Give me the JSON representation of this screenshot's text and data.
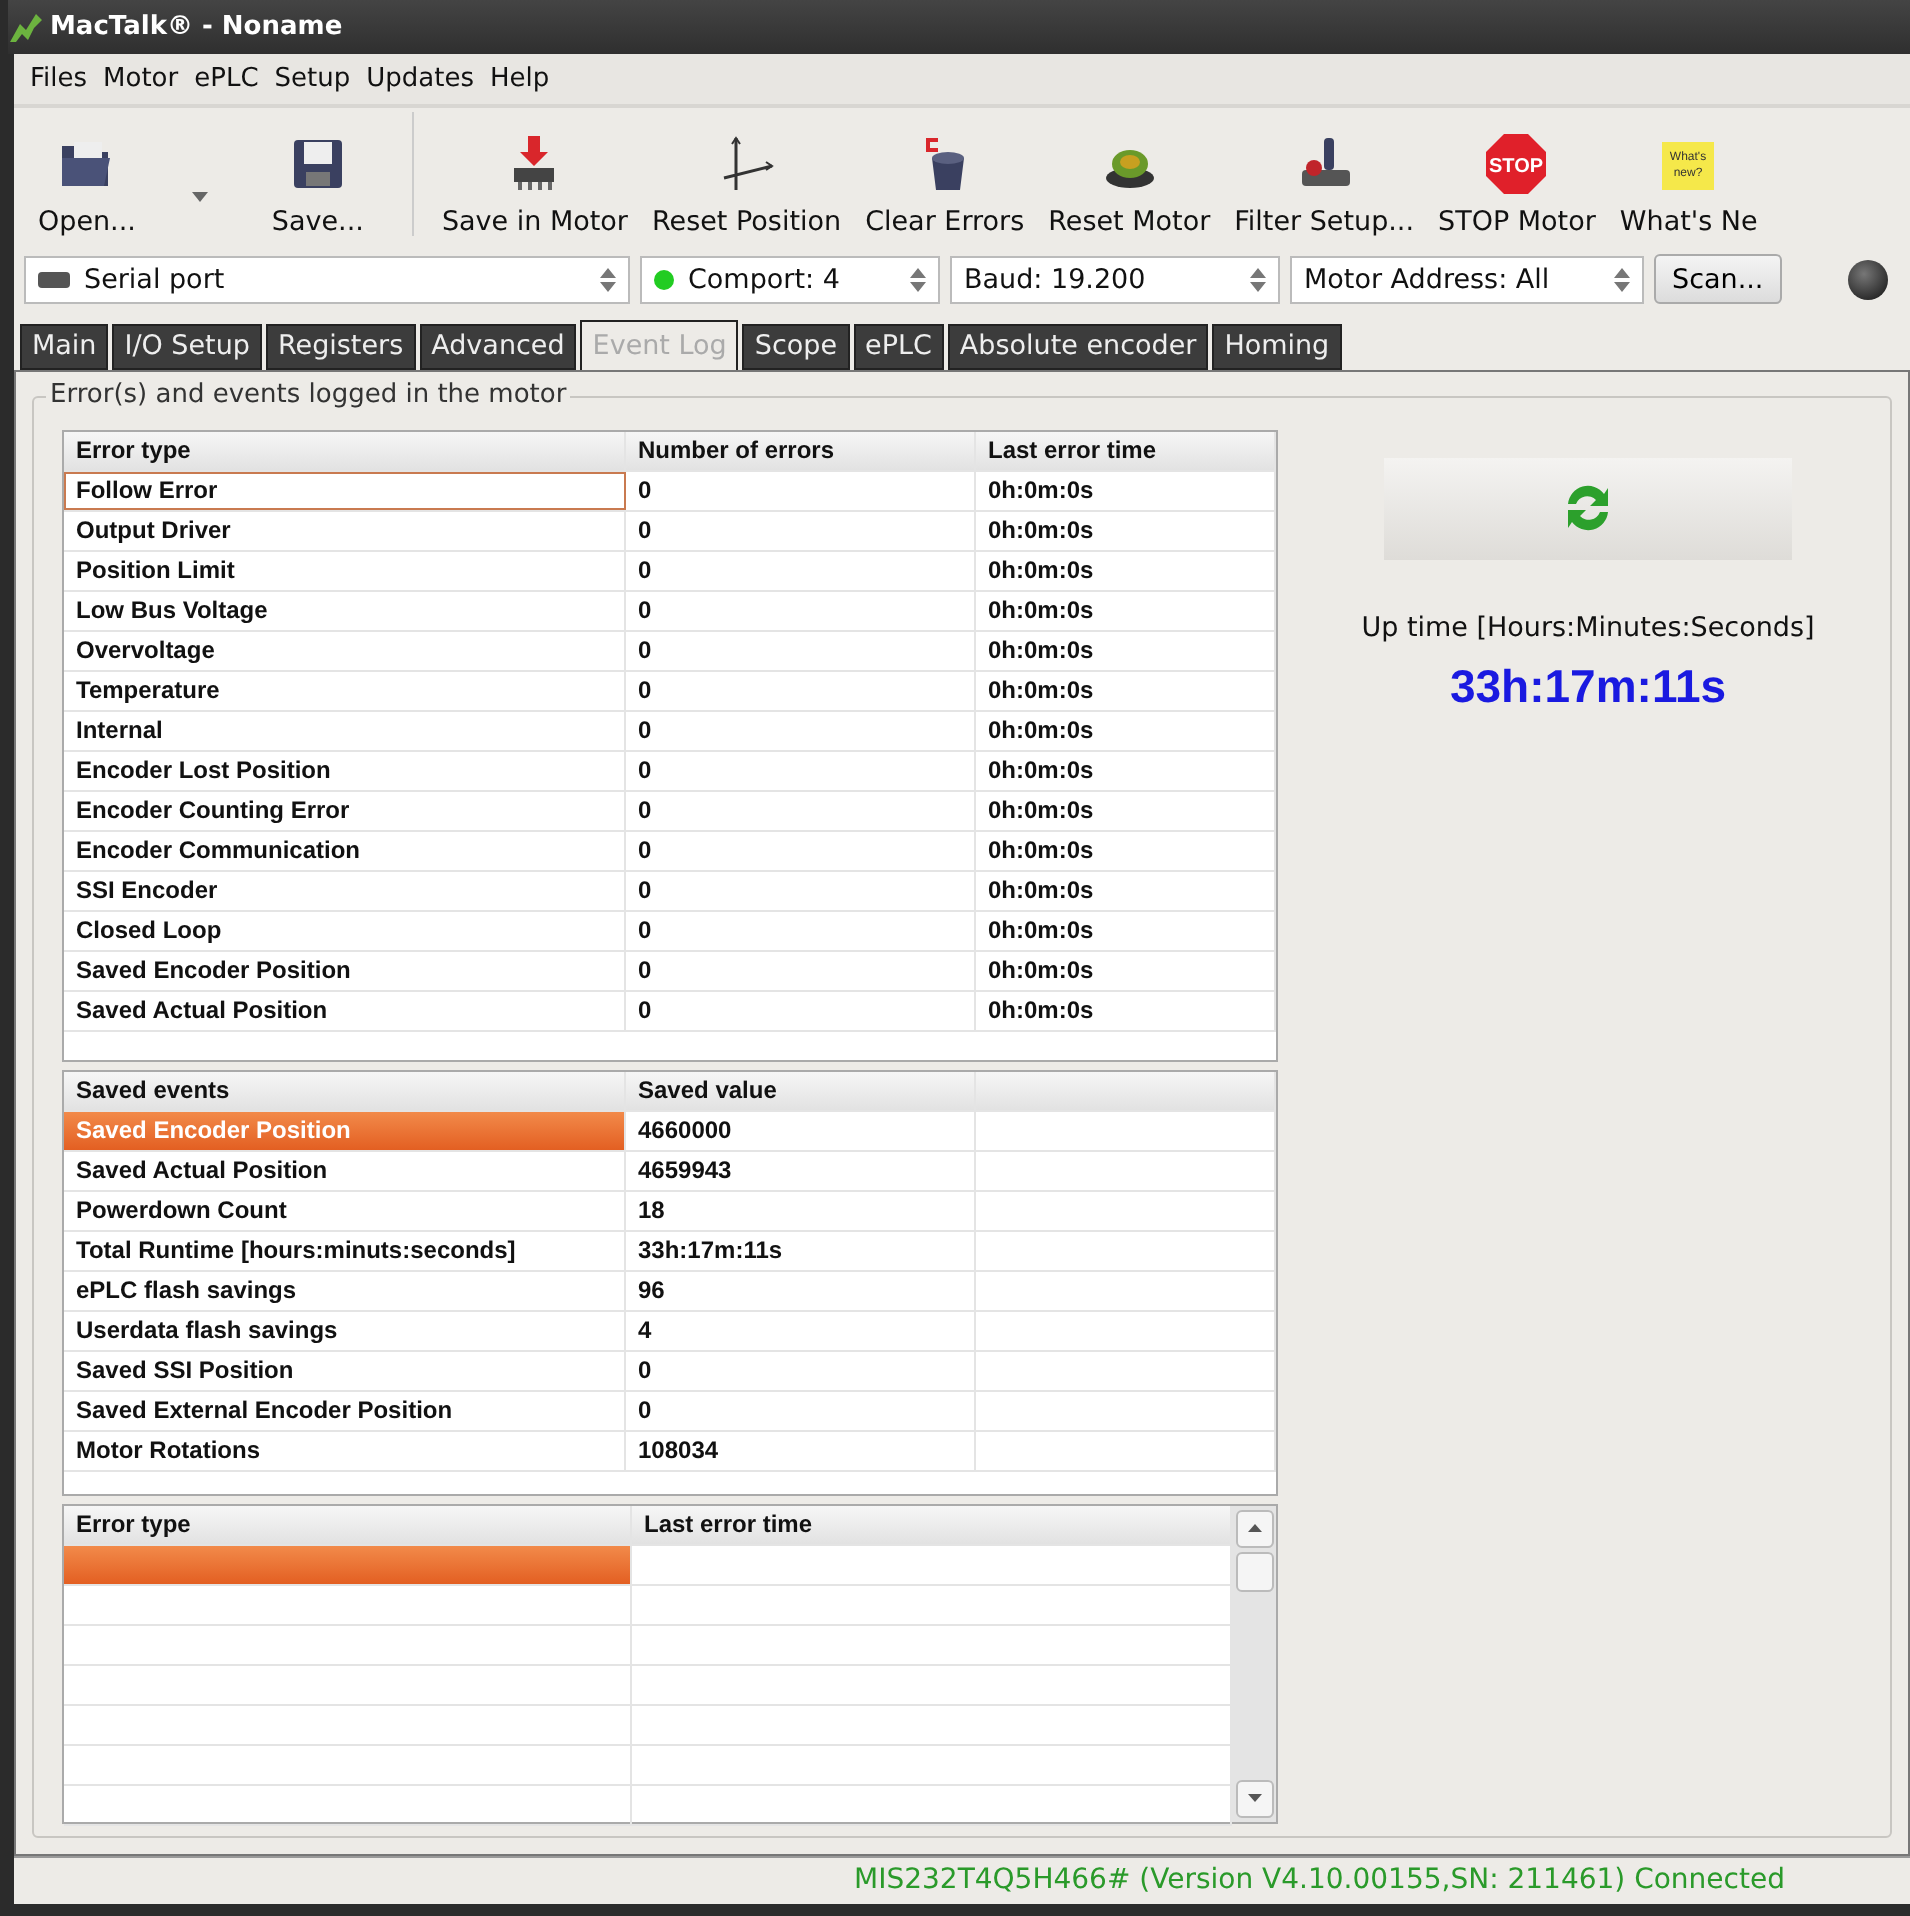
{
  "window": {
    "title": "MacTalk® - Noname"
  },
  "menu": [
    "Files",
    "Motor",
    "ePLC",
    "Setup",
    "Updates",
    "Help"
  ],
  "toolbar": [
    {
      "label": "Open...",
      "has_menu": true
    },
    {
      "label": "Save...",
      "has_menu": false
    },
    {
      "label": "Save in Motor",
      "has_menu": false
    },
    {
      "label": "Reset Position",
      "has_menu": false
    },
    {
      "label": "Clear Errors",
      "has_menu": false
    },
    {
      "label": "Reset Motor",
      "has_menu": false
    },
    {
      "label": "Filter Setup...",
      "has_menu": false
    },
    {
      "label": "STOP Motor",
      "has_menu": false
    },
    {
      "label": "What's Ne",
      "has_menu": false
    }
  ],
  "stop_icon_text": "STOP",
  "note_icon_text": [
    "What's",
    "new?"
  ],
  "connection": {
    "port": "Serial port",
    "comport": "Comport: 4",
    "comport_connected": true,
    "baud": "Baud: 19.200",
    "address": "Motor Address: All",
    "scan": "Scan..."
  },
  "tabs": [
    {
      "label": "Main",
      "selected": false
    },
    {
      "label": "I/O Setup",
      "selected": false
    },
    {
      "label": "Registers",
      "selected": false
    },
    {
      "label": "Advanced",
      "selected": false
    },
    {
      "label": "Event Log",
      "selected": true
    },
    {
      "label": "Scope",
      "selected": false
    },
    {
      "label": "ePLC",
      "selected": false
    },
    {
      "label": "Absolute encoder",
      "selected": false
    },
    {
      "label": "Homing",
      "selected": false
    }
  ],
  "group_title": "Error(s) and events logged in the motor",
  "error_table": {
    "columns": [
      "Error type",
      "Number of errors",
      "Last error time"
    ],
    "rows": [
      {
        "cells": [
          "Follow Error",
          "0",
          "0h:0m:0s"
        ],
        "focused": true
      },
      {
        "cells": [
          "Output Driver",
          "0",
          "0h:0m:0s"
        ],
        "focused": false
      },
      {
        "cells": [
          "Position Limit",
          "0",
          "0h:0m:0s"
        ],
        "focused": false
      },
      {
        "cells": [
          "Low Bus Voltage",
          "0",
          "0h:0m:0s"
        ],
        "focused": false
      },
      {
        "cells": [
          "Overvoltage",
          "0",
          "0h:0m:0s"
        ],
        "focused": false
      },
      {
        "cells": [
          "Temperature",
          "0",
          "0h:0m:0s"
        ],
        "focused": false
      },
      {
        "cells": [
          "Internal",
          "0",
          "0h:0m:0s"
        ],
        "focused": false
      },
      {
        "cells": [
          "Encoder Lost Position",
          "0",
          "0h:0m:0s"
        ],
        "focused": false
      },
      {
        "cells": [
          "Encoder Counting Error",
          "0",
          "0h:0m:0s"
        ],
        "focused": false
      },
      {
        "cells": [
          "Encoder Communication",
          "0",
          "0h:0m:0s"
        ],
        "focused": false
      },
      {
        "cells": [
          "SSI Encoder",
          "0",
          "0h:0m:0s"
        ],
        "focused": false
      },
      {
        "cells": [
          "Closed Loop",
          "0",
          "0h:0m:0s"
        ],
        "focused": false
      },
      {
        "cells": [
          "Saved Encoder Position",
          "0",
          "0h:0m:0s"
        ],
        "focused": false
      },
      {
        "cells": [
          "Saved Actual Position",
          "0",
          "0h:0m:0s"
        ],
        "focused": false
      }
    ]
  },
  "events_table": {
    "columns": [
      "Saved events",
      "Saved value"
    ],
    "rows": [
      {
        "cells": [
          "Saved Encoder Position",
          "4660000"
        ],
        "selected": true
      },
      {
        "cells": [
          "Saved Actual Position",
          "4659943"
        ],
        "selected": false
      },
      {
        "cells": [
          "Powerdown Count",
          "18"
        ],
        "selected": false
      },
      {
        "cells": [
          "Total Runtime [hours:minuts:seconds]",
          "33h:17m:11s"
        ],
        "selected": false
      },
      {
        "cells": [
          "ePLC flash savings",
          "96"
        ],
        "selected": false
      },
      {
        "cells": [
          "Userdata flash savings",
          "4"
        ],
        "selected": false
      },
      {
        "cells": [
          "Saved SSI Position",
          "0"
        ],
        "selected": false
      },
      {
        "cells": [
          "Saved External Encoder Position",
          "0"
        ],
        "selected": false
      },
      {
        "cells": [
          "Motor Rotations",
          "108034"
        ],
        "selected": false
      }
    ]
  },
  "history_table": {
    "columns": [
      "Error type",
      "Last error time"
    ],
    "rows": [
      {
        "selected": true
      },
      {
        "selected": false
      },
      {
        "selected": false
      },
      {
        "selected": false
      },
      {
        "selected": false
      },
      {
        "selected": false
      },
      {
        "selected": false
      }
    ]
  },
  "uptime": {
    "label": "Up time [Hours:Minutes:Seconds]",
    "value": "33h:17m:11s"
  },
  "status_bar": "MIS232T4Q5H466# (Version V4.10.00155,SN: 211461) Connected"
}
